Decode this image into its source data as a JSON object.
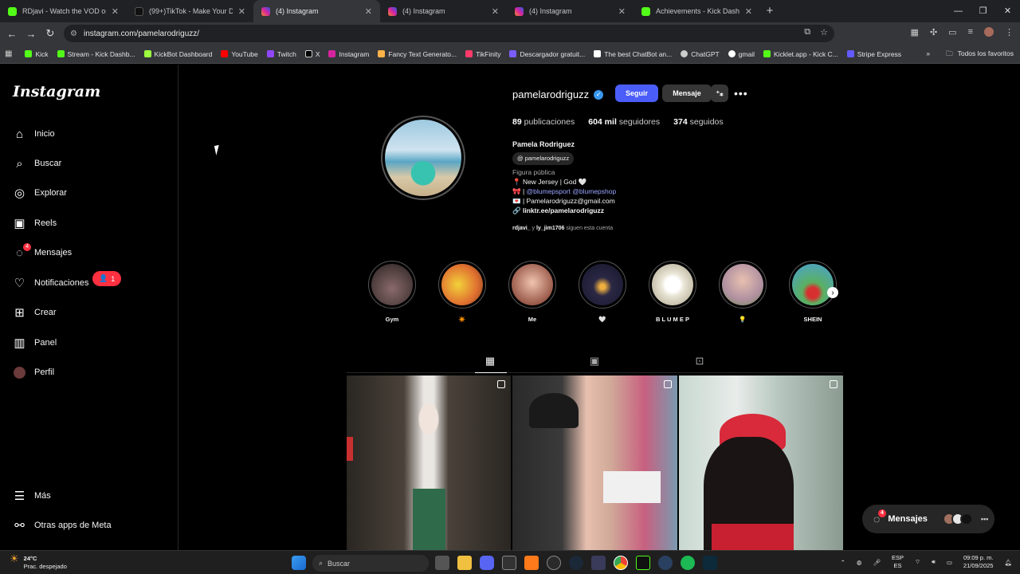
{
  "tabs": [
    {
      "title": "RDjavi - Watch the VOD on Kick",
      "color": "#53fc18"
    },
    {
      "title": "(99+)TikTok - Make Your Day",
      "color": "#111111"
    },
    {
      "title": "(4) Instagram",
      "color": "#d6249f"
    },
    {
      "title": "(4) Instagram",
      "color": "#d6249f"
    },
    {
      "title": "(4) Instagram",
      "color": "#d6249f"
    },
    {
      "title": "Achievements - Kick Dashboard",
      "color": "#53fc18"
    }
  ],
  "address": {
    "url": "instagram.com/pamelarodriguzz/"
  },
  "bookmarks": [
    {
      "label": "Kick",
      "color": "#53fc18"
    },
    {
      "label": "Stream - Kick Dashb...",
      "color": "#53fc18"
    },
    {
      "label": "KickBot Dashboard",
      "color": "#9cff3f"
    },
    {
      "label": "YouTube",
      "color": "#ff0000"
    },
    {
      "label": "Twitch",
      "color": "#9146ff"
    },
    {
      "label": "X",
      "color": "#ffffff"
    },
    {
      "label": "Instagram",
      "color": "#d6249f"
    },
    {
      "label": "Fancy Text Generato...",
      "color": "#ffb347"
    },
    {
      "label": "TikFinity",
      "color": "#ff3a6a"
    },
    {
      "label": "Descargador gratuit...",
      "color": "#7b5cff"
    },
    {
      "label": "The best ChatBot an...",
      "color": "#ffffff"
    },
    {
      "label": "ChatGPT",
      "color": "#cccccc"
    },
    {
      "label": "gmail",
      "color": "#ffffff"
    },
    {
      "label": "Kicklet.app - Kick C...",
      "color": "#53fc18"
    },
    {
      "label": "Stripe Express",
      "color": "#635bff"
    }
  ],
  "bookmarks_all": "Todos los favoritos",
  "sidebar": {
    "items": [
      {
        "label": "Inicio",
        "icon": "home-icon"
      },
      {
        "label": "Buscar",
        "icon": "search-icon"
      },
      {
        "label": "Explorar",
        "icon": "compass-icon"
      },
      {
        "label": "Reels",
        "icon": "reels-icon"
      },
      {
        "label": "Mensajes",
        "icon": "messenger-icon",
        "badge": "4"
      },
      {
        "label": "Notificaciones",
        "icon": "heart-icon"
      },
      {
        "label": "Crear",
        "icon": "plus-square-icon"
      },
      {
        "label": "Panel",
        "icon": "chart-icon"
      },
      {
        "label": "Perfil",
        "icon": "avatar-icon"
      },
      {
        "label": "Más",
        "icon": "menu-icon"
      },
      {
        "label": "Otras apps de Meta",
        "icon": "meta-icon"
      }
    ],
    "notif_count": "1"
  },
  "logo": "Instagram",
  "profile": {
    "username": "pamelarodriguzz",
    "follow_label": "Seguir",
    "message_label": "Mensaje",
    "posts_count": "89",
    "posts_label": "publicaciones",
    "followers_count": "604 mil",
    "followers_label": "seguidores",
    "following_count": "374",
    "following_label": "seguidos",
    "full_name": "Pamela Rodriguez",
    "threads_handle": "pamelarodriguzz",
    "category": "Figura pública",
    "bio_line1": "📍 New Jersey | God 🤍",
    "bio_line2_prefix": "🎀 | ",
    "bio_line2_link": "@blumepsport @blumepshop",
    "bio_line3": "💌 | Pamelarodriguzz@gmail.com",
    "bio_link": "linktr.ee/pamelarodriguzz",
    "followed_by_1": "rdjavi_",
    "followed_by_mid": " y ",
    "followed_by_2": "ly_jim1706",
    "followed_by_suffix": " siguen esta cuenta"
  },
  "highlights": [
    {
      "label": "Gym",
      "color": "#5b4a4a"
    },
    {
      "label": "✴️",
      "color": "#e6c23a"
    },
    {
      "label": "Me",
      "color": "#d8a08a"
    },
    {
      "label": "🤍",
      "color": "#3a3550"
    },
    {
      "label": "B L U M E P",
      "color": "#e8e4d4"
    },
    {
      "label": "💡",
      "color": "#b8a0a8"
    },
    {
      "label": "SHEIN",
      "color": "#4aa0d8"
    }
  ],
  "messages_pill": {
    "label": "Mensajes",
    "badge": "4"
  },
  "taskbar": {
    "temp": "24°C",
    "weather": "Prac. despejado",
    "search": "Buscar",
    "lang1": "ESP",
    "lang2": "ES",
    "time": "09:09 p. m.",
    "date": "21/09/2025"
  }
}
